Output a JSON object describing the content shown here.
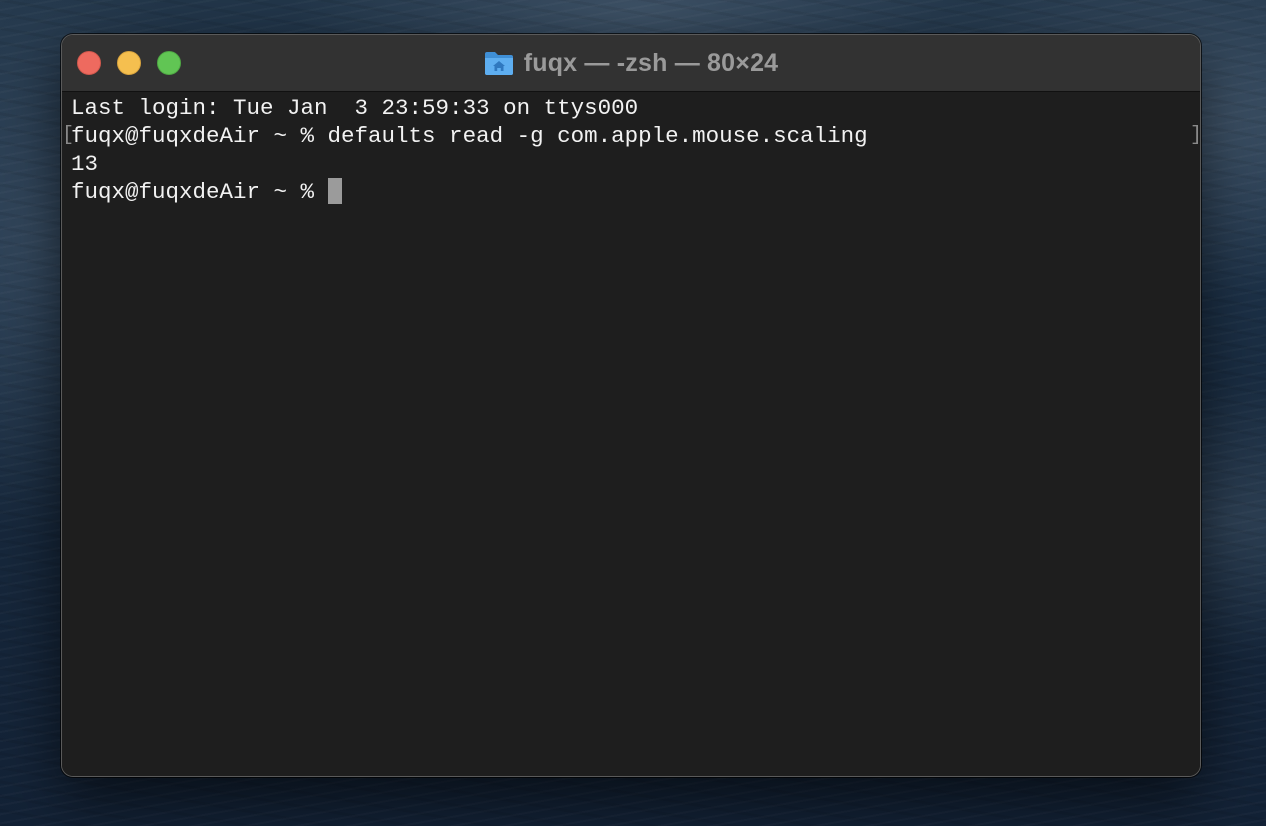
{
  "window": {
    "title": "fuqx — -zsh — 80×24",
    "folder_icon": "home-folder-icon"
  },
  "traffic_lights": {
    "close_color": "#ee6a5f",
    "minimize_color": "#f5bf4f",
    "maximize_color": "#61c554"
  },
  "terminal": {
    "background": "#1e1e1e",
    "foreground": "#f2f2f2",
    "lines": [
      "Last login: Tue Jan  3 23:59:33 on ttys000",
      "fuqx@fuqxdeAir ~ % defaults read -g com.apple.mouse.scaling",
      "13"
    ],
    "prompt": "fuqx@fuqxdeAir ~ % ",
    "mark_left": "[",
    "mark_right": "]"
  }
}
